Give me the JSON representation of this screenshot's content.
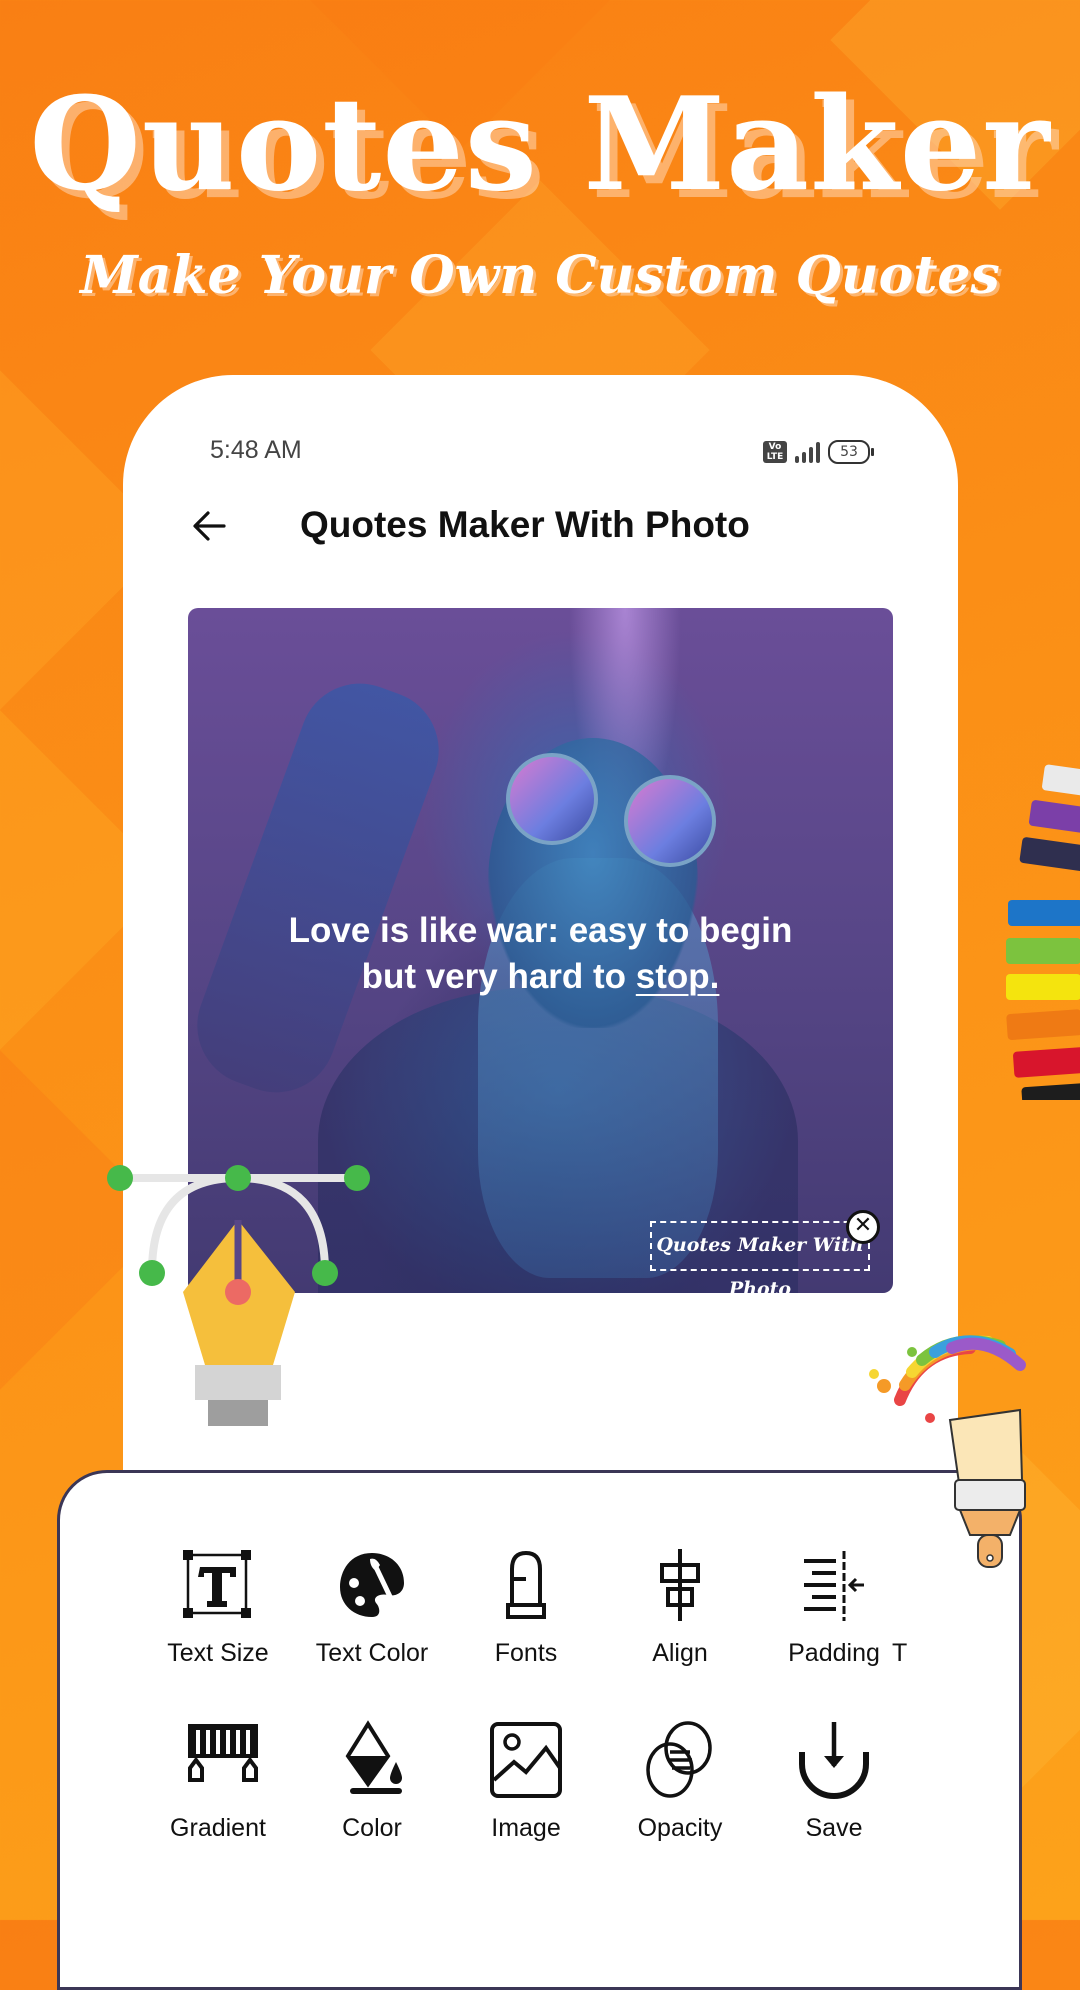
{
  "hero": {
    "title": "Quotes Maker",
    "subtitle": "Make  Your Own Custom Quotes"
  },
  "status_bar": {
    "time": "5:48 AM",
    "network_badge": "Vo LTE",
    "signal_icon": "signal-bars-icon",
    "battery_level": "53"
  },
  "app_bar": {
    "back_icon": "arrow-left-icon",
    "title": "Quotes Maker With Photo"
  },
  "canvas": {
    "quote_line1": "Love is like war: easy to begin",
    "quote_line2_prefix": "but very hard to ",
    "quote_line2_underlined": "stop.",
    "watermark_text": "Quotes Maker With Photo",
    "watermark_close_icon": "close-circle-icon"
  },
  "tools": {
    "row1": [
      {
        "label": "Text Size",
        "icon": "text-size-icon"
      },
      {
        "label": "Text Color",
        "icon": "palette-icon"
      },
      {
        "label": "Fonts",
        "icon": "font-icon"
      },
      {
        "label": "Align",
        "icon": "align-center-icon"
      },
      {
        "label": "Padding",
        "icon": "padding-icon"
      },
      {
        "label": "T",
        "icon": "text-icon"
      }
    ],
    "row2": [
      {
        "label": "Gradient",
        "icon": "gradient-icon"
      },
      {
        "label": "Color",
        "icon": "paint-bucket-icon"
      },
      {
        "label": "Image",
        "icon": "image-icon"
      },
      {
        "label": "Opacity",
        "icon": "opacity-icon"
      },
      {
        "label": "Save",
        "icon": "save-download-icon"
      }
    ]
  },
  "colors": {
    "background_orange": "#f98a16",
    "panel_border": "#3b3656",
    "pen_yellow": "#f5bf3c",
    "anchor_green": "#46b94a"
  }
}
